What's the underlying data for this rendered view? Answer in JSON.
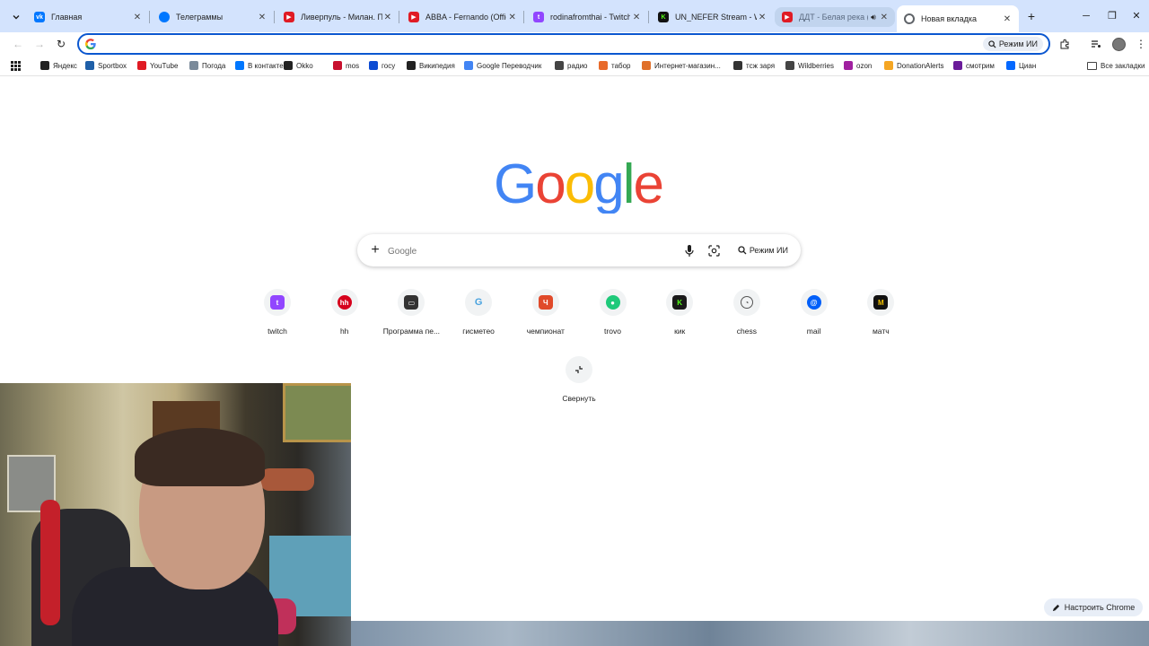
{
  "browser": {
    "tabs": [
      {
        "title": "Главная",
        "favicon": "vk-icon",
        "color": "#0077ff"
      },
      {
        "title": "Телеграммы",
        "favicon": "chat-icon",
        "color": "#0077ff"
      },
      {
        "title": "Ливерпуль - Милан. Пол",
        "favicon": "youtube-icon",
        "color": "#e01b24"
      },
      {
        "title": "ABBA - Fernando (Officia",
        "favicon": "youtube-icon",
        "color": "#e01b24"
      },
      {
        "title": "rodinafromthai - Twitch",
        "favicon": "twitch-icon",
        "color": "#9146ff"
      },
      {
        "title": "UN_NEFER Stream - Watc",
        "favicon": "kick-icon",
        "color": "#53fc18"
      },
      {
        "title": "ДДТ - Белая река (Of",
        "favicon": "youtube-icon",
        "color": "#e01b24"
      },
      {
        "title": "Новая вкладка",
        "favicon": "chrome-icon",
        "color": "#5f6368"
      }
    ],
    "active_tab_index": 7,
    "omnibox": {
      "value": "",
      "ai_mode_label": "Режим ИИ"
    }
  },
  "bookmarks": [
    {
      "label": "Яндекс",
      "icon": "yandex-icon",
      "color": "#222222"
    },
    {
      "label": "Sportbox",
      "icon": "sportbox-icon",
      "color": "#1e5fa8"
    },
    {
      "label": "YouTube",
      "icon": "youtube-icon",
      "color": "#e01b24"
    },
    {
      "label": "Погода",
      "icon": "weather-icon",
      "color": "#7a8a9a"
    },
    {
      "label": "В контакте",
      "icon": "vk-icon",
      "color": "#0077ff"
    },
    {
      "label": "Okko",
      "icon": "okko-icon",
      "color": "#222222"
    },
    {
      "label": "mos",
      "icon": "mos-icon",
      "color": "#c8102e"
    },
    {
      "label": "госу",
      "icon": "gosuslugi-icon",
      "color": "#0d4cd3"
    },
    {
      "label": "Википедия",
      "icon": "wikipedia-icon",
      "color": "#222222"
    },
    {
      "label": "Google Переводчик",
      "icon": "translate-icon",
      "color": "#4285f4"
    },
    {
      "label": "радио",
      "icon": "folder-icon",
      "color": "#444444"
    },
    {
      "label": "табор",
      "icon": "tabor-icon",
      "color": "#e86a2a"
    },
    {
      "label": "Интернет-магазин...",
      "icon": "shop-icon",
      "color": "#e0702a"
    },
    {
      "label": "тсж заря",
      "icon": "tszh-icon",
      "color": "#333333"
    },
    {
      "label": "Wildberries",
      "icon": "globe-icon",
      "color": "#444444"
    },
    {
      "label": "ozon",
      "icon": "ozon-icon",
      "color": "#a020a0"
    },
    {
      "label": "DonationAlerts",
      "icon": "donationalerts-icon",
      "color": "#f5a623"
    },
    {
      "label": "смотрим",
      "icon": "smotrim-icon",
      "color": "#6a1b9a"
    },
    {
      "label": "Циан",
      "icon": "cian-icon",
      "color": "#0468ff"
    }
  ],
  "all_bookmarks_label": "Все закладки",
  "newtab": {
    "logo_text": "Google",
    "search_placeholder": "Google",
    "ai_mode_label": "Режим ИИ",
    "shortcuts": [
      {
        "label": "twitch",
        "icon": "twitch-icon",
        "color": "#9146ff"
      },
      {
        "label": "hh",
        "icon": "hh-icon",
        "color": "#d6001c"
      },
      {
        "label": "Программа пе...",
        "icon": "tv-program-icon",
        "color": "#333333"
      },
      {
        "label": "гисметео",
        "icon": "gismeteo-icon",
        "color": "#4aa3df"
      },
      {
        "label": "чемпионат",
        "icon": "championat-icon",
        "color": "#e04a2a"
      },
      {
        "label": "trovo",
        "icon": "trovo-icon",
        "color": "#1ec97a"
      },
      {
        "label": "кик",
        "icon": "kick-icon",
        "color": "#1a1a1a"
      },
      {
        "label": "chess",
        "icon": "chess-icon",
        "color": "#555555"
      },
      {
        "label": "mail",
        "icon": "mail-icon",
        "color": "#005ff9"
      },
      {
        "label": "матч",
        "icon": "match-icon",
        "color": "#111111"
      }
    ],
    "collapse_label": "Свернуть",
    "customize_label": "Настроить Chrome"
  }
}
